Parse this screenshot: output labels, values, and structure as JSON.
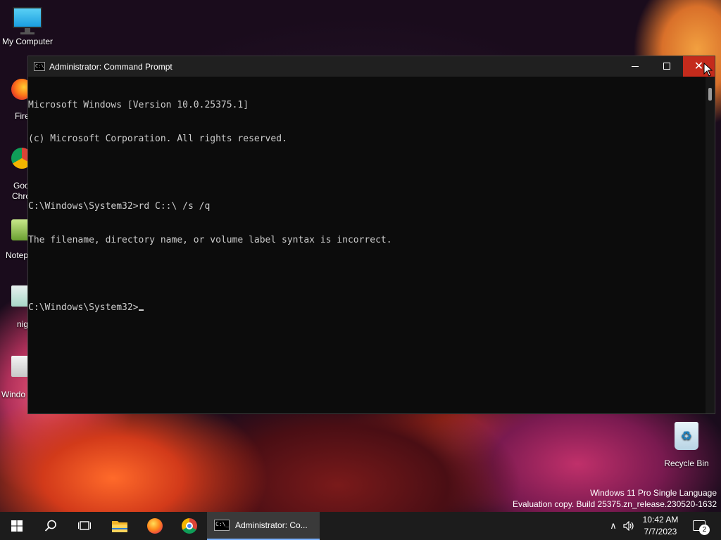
{
  "desktop": {
    "icons": [
      {
        "label": "My Computer",
        "icon": "monitor-icon"
      },
      {
        "label": "Fire",
        "icon": "firefox-icon"
      },
      {
        "label": "Goo",
        "label2": "Chro",
        "icon": "chrome-icon"
      },
      {
        "label": "Notep",
        "icon": "notepad-icon"
      },
      {
        "label": "nig",
        "icon": "file-icon"
      },
      {
        "label": "Windo",
        "icon": "document-icon"
      }
    ],
    "recycle_bin": {
      "label": "Recycle Bin",
      "icon": "recycle-bin-icon"
    },
    "watermark": {
      "line1": "Windows 11 Pro Single Language",
      "line2": "Evaluation copy. Build 25375.zn_release.230520-1632"
    }
  },
  "window": {
    "title": "Administrator: Command Prompt",
    "app_icon_text": "C:\\",
    "console_lines": [
      "Microsoft Windows [Version 10.0.25375.1]",
      "(c) Microsoft Corporation. All rights reserved.",
      "",
      "C:\\Windows\\System32>rd C::\\ /s /q",
      "The filename, directory name, or volume label syntax is incorrect.",
      "",
      "C:\\Windows\\System32>"
    ],
    "controls": {
      "minimize": "—",
      "maximize": "☐",
      "close": "✕"
    }
  },
  "taskbar": {
    "active_task": {
      "label": "Administrator:  Co...",
      "icon_text": "C:\\_"
    },
    "clock": {
      "time": "10:42 AM",
      "date": "7/7/2023"
    },
    "notification_count": "2",
    "tray_chevron": "∧",
    "volume_glyph": "🔈"
  },
  "colors": {
    "console_bg": "#0c0c0c",
    "console_fg": "#cccccc",
    "close_hover": "#c42b1c",
    "taskbar_bg": "#1c1c1c"
  }
}
